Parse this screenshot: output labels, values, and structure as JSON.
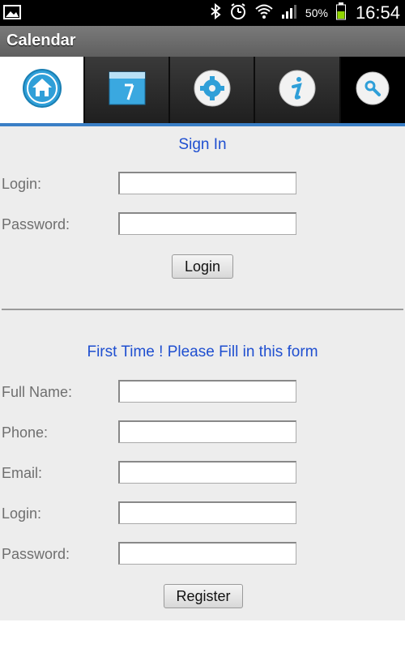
{
  "status_bar": {
    "battery_percent": "50%",
    "time": "16:54"
  },
  "app": {
    "title": "Calendar"
  },
  "tabs": [
    {
      "name": "home-tab",
      "icon": "home-icon",
      "active": true
    },
    {
      "name": "calendar-tab",
      "icon": "calendar-icon",
      "text": "7",
      "active": false
    },
    {
      "name": "settings-tab",
      "icon": "gear-icon",
      "active": false
    },
    {
      "name": "info-tab",
      "icon": "info-icon",
      "active": false
    },
    {
      "name": "search-tab",
      "icon": "search-icon",
      "active": false
    }
  ],
  "sign_in": {
    "title": "Sign In",
    "login_label": "Login:",
    "password_label": "Password:",
    "login_value": "",
    "password_value": "",
    "button_label": "Login"
  },
  "register": {
    "title": "First Time ! Please Fill in this form",
    "full_name_label": "Full Name:",
    "phone_label": "Phone:",
    "email_label": "Email:",
    "login_label": "Login:",
    "password_label": "Password:",
    "button_label": "Register"
  },
  "colors": {
    "accent": "#3a7fc6",
    "title_text": "#1f4fd0"
  }
}
